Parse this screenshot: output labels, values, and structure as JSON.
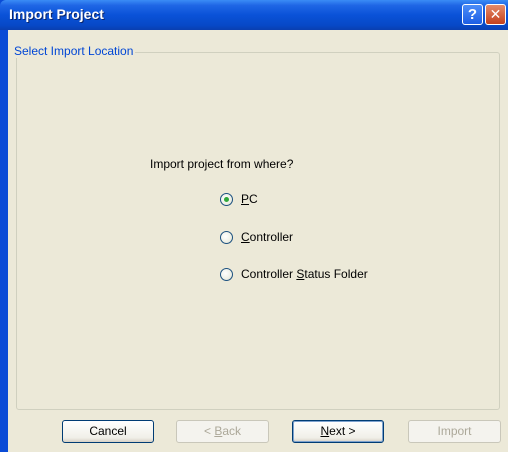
{
  "window": {
    "title": "Import Project",
    "help_glyph": "?",
    "close_glyph": "✕"
  },
  "group": {
    "caption": "Select Import Location"
  },
  "question": "Import project from where?",
  "options": [
    {
      "pre": "",
      "accel": "P",
      "post": "C",
      "checked": true
    },
    {
      "pre": "",
      "accel": "C",
      "post": "ontroller",
      "checked": false
    },
    {
      "pre": "Controller ",
      "accel": "S",
      "post": "tatus Folder",
      "checked": false
    }
  ],
  "buttons": {
    "cancel": {
      "pre": "Cancel",
      "accel": "",
      "post": ""
    },
    "back": {
      "pre": "< ",
      "accel": "B",
      "post": "ack"
    },
    "next": {
      "pre": "",
      "accel": "N",
      "post": "ext >"
    },
    "import": {
      "pre": "Import",
      "accel": "",
      "post": ""
    }
  },
  "colors": {
    "titlebar": "#0a52d8",
    "face": "#ece9d8",
    "group_caption": "#0046d5",
    "radio_dot": "#2fa83a"
  }
}
